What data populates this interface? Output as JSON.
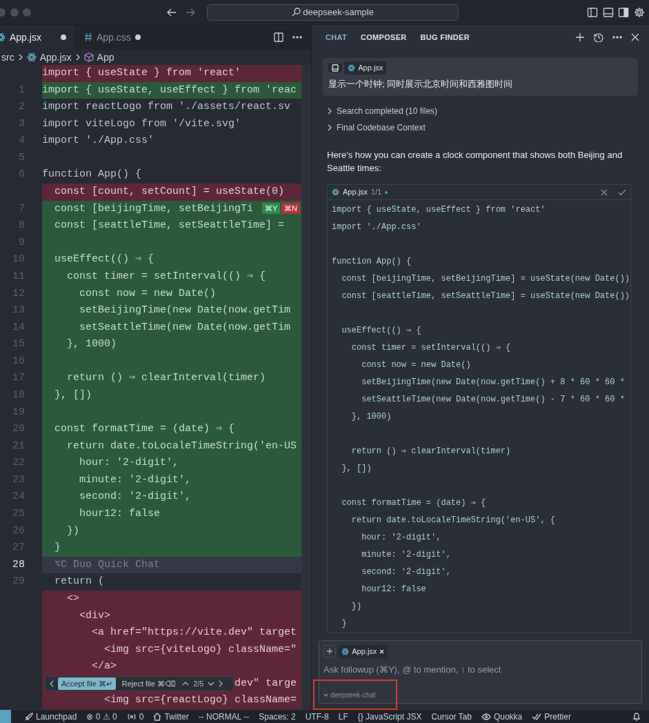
{
  "window": {
    "search": "deepseek-sample"
  },
  "editor": {
    "tabs": [
      {
        "label": "App.jsx",
        "modified": true,
        "selected": true
      },
      {
        "label": "App.css",
        "modified": true,
        "selected": false
      }
    ],
    "breadcrumb": [
      "src",
      "App.jsx",
      "App"
    ],
    "lines": [
      {
        "kind": "removed",
        "text": "import { useState } from 'react'"
      },
      {
        "kind": "added",
        "number": "1",
        "text": "import { useState, useEffect } from 'reac"
      },
      {
        "kind": "plain",
        "number": "2",
        "text": "import reactLogo from './assets/react.sv"
      },
      {
        "kind": "plain",
        "number": "3",
        "text": "import viteLogo from '/vite.svg'"
      },
      {
        "kind": "plain",
        "number": "4",
        "text": "import './App.css'"
      },
      {
        "kind": "plain",
        "number": "5"
      },
      {
        "kind": "plain",
        "number": "6",
        "text": "function App() {"
      },
      {
        "kind": "removed",
        "text": "  const [count, setCount] = useState(0)"
      },
      {
        "kind": "added",
        "number": "7",
        "text": "  const [beijingTime, setBeijingTi",
        "badges": [
          {
            "kind": "accept",
            "label": "⌘Y"
          },
          {
            "kind": "reject",
            "label": "⌘N"
          }
        ]
      },
      {
        "kind": "added",
        "number": "8",
        "text": "  const [seattleTime, setSeattleTime] ="
      },
      {
        "kind": "added",
        "number": "9"
      },
      {
        "kind": "added",
        "number": "10",
        "text": "  useEffect(() ⇒ {"
      },
      {
        "kind": "added",
        "number": "11",
        "text": "    const timer = setInterval(() ⇒ {"
      },
      {
        "kind": "added",
        "number": "12",
        "text": "      const now = new Date()"
      },
      {
        "kind": "added",
        "number": "13",
        "text": "      setBeijingTime(new Date(now.getTim"
      },
      {
        "kind": "added",
        "number": "14",
        "text": "      setSeattleTime(new Date(now.getTim"
      },
      {
        "kind": "added",
        "number": "15",
        "text": "    }, 1000)"
      },
      {
        "kind": "added",
        "number": "16"
      },
      {
        "kind": "added",
        "number": "17",
        "text": "    return () ⇒ clearInterval(timer)"
      },
      {
        "kind": "added",
        "number": "18",
        "text": "  }, [])"
      },
      {
        "kind": "added",
        "number": "19"
      },
      {
        "kind": "added",
        "number": "20",
        "text": "  const formatTime = (date) ⇒ {"
      },
      {
        "kind": "added",
        "number": "21",
        "text": "    return date.toLocaleTimeString('en-US"
      },
      {
        "kind": "added",
        "number": "22",
        "text": "      hour: '2-digit',"
      },
      {
        "kind": "added",
        "number": "23",
        "text": "      minute: '2-digit',"
      },
      {
        "kind": "added",
        "number": "24",
        "text": "      second: '2-digit',"
      },
      {
        "kind": "added",
        "number": "25",
        "text": "      hour12: false"
      },
      {
        "kind": "added",
        "number": "26",
        "text": "    })"
      },
      {
        "kind": "added",
        "number": "27",
        "text": "  }"
      },
      {
        "kind": "current",
        "number": "28",
        "text": "  ⌥C Duo Quick Chat"
      },
      {
        "kind": "plain",
        "number": "29",
        "text": "  return ("
      },
      {
        "kind": "removed",
        "text": "    <>"
      },
      {
        "kind": "removed",
        "text": "      <div>"
      },
      {
        "kind": "removed",
        "text": "        <a href=\"https://vite.dev\" target"
      },
      {
        "kind": "removed",
        "text": "          <img src={viteLogo} className=\""
      },
      {
        "kind": "removed",
        "text": "        </a>"
      },
      {
        "kind": "removed",
        "text": "                               dev\" targe"
      },
      {
        "kind": "removed",
        "text": "          <img src={reactLogo} className="
      }
    ],
    "review_bar": {
      "accept": "Accept file ⌘↵",
      "reject": "Reject file ⌘⌫",
      "position": "2/5"
    }
  },
  "chat": {
    "tabs": [
      {
        "label": "CHAT",
        "selected": true
      },
      {
        "label": "COMPOSER",
        "selected": false
      },
      {
        "label": "BUG FINDER",
        "selected": false
      }
    ],
    "message": {
      "chip": "App.jsx",
      "text": "显示一个时钟; 同时展示北京时间和西雅图时间"
    },
    "steps": [
      "Search completed (10 files)",
      "Final Codebase Context"
    ],
    "answer": "Here's how you can create a clock component that shows both Beijing and Seattle times:",
    "code_block": {
      "file": "App.jsx",
      "count": "1/1",
      "lines": [
        {
          "kind": "code",
          "text": "import { useState, useEffect } from 'react'"
        },
        {
          "kind": "code",
          "text": "import './App.css'"
        },
        {
          "kind": "blank"
        },
        {
          "kind": "code",
          "text": "function App() {"
        },
        {
          "kind": "code",
          "text": "  const [beijingTime, setBeijingTime] = useState(new Date())"
        },
        {
          "kind": "code",
          "text": "  const [seattleTime, setSeattleTime] = useState(new Date())"
        },
        {
          "kind": "blank"
        },
        {
          "kind": "code",
          "text": "  useEffect(() ⇒ {"
        },
        {
          "kind": "code",
          "text": "    const timer = setInterval(() ⇒ {"
        },
        {
          "kind": "code",
          "text": "      const now = new Date()"
        },
        {
          "kind": "code",
          "text": "      setBeijingTime(new Date(now.getTime() + 8 * 60 * 60 *"
        },
        {
          "kind": "code",
          "text": "      setSeattleTime(new Date(now.getTime() - 7 * 60 * 60 *"
        },
        {
          "kind": "code",
          "text": "    }, 1000)"
        },
        {
          "kind": "blank"
        },
        {
          "kind": "code",
          "text": "    return () ⇒ clearInterval(timer)"
        },
        {
          "kind": "code",
          "text": "  }, [])"
        },
        {
          "kind": "blank"
        },
        {
          "kind": "code",
          "text": "  const formatTime = (date) ⇒ {"
        },
        {
          "kind": "code",
          "text": "    return date.toLocaleTimeString('en-US', {"
        },
        {
          "kind": "code",
          "text": "      hour: '2-digit',"
        },
        {
          "kind": "code",
          "text": "      minute: '2-digit',"
        },
        {
          "kind": "code",
          "text": "      second: '2-digit',"
        },
        {
          "kind": "code",
          "text": "      hour12: false"
        },
        {
          "kind": "code",
          "text": "    })"
        },
        {
          "kind": "code",
          "text": "  }"
        }
      ]
    },
    "composer": {
      "chip": "App.jsx",
      "placeholder": "Ask followup (⌘Y), @ to mention, ↑ to select",
      "model": "deepseek-chat"
    }
  },
  "status_bar": [
    "Launchpad",
    "⊗ 0 ⚠ 0",
    "0",
    "Twitter",
    "-- NORMAL --",
    "Spaces: 2",
    "UTF-8",
    "LF",
    "{} JavaScript JSX",
    "Cursor Tab",
    "Quokka",
    "Prettier"
  ]
}
